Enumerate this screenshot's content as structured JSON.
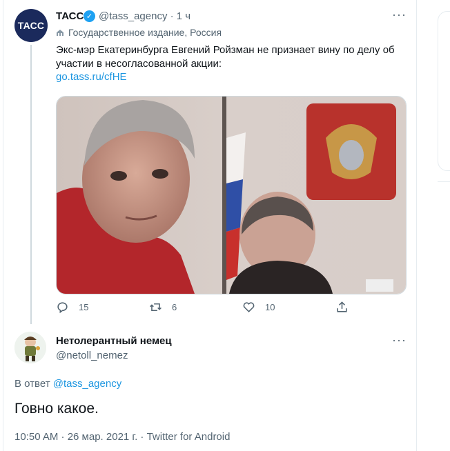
{
  "main_tweet": {
    "avatar_text": "ТАСС",
    "author_name": "ТАСС",
    "handle": "@tass_agency",
    "separator": "·",
    "age": "1 ч",
    "label": "Государственное издание, Россия",
    "text": "Экс-мэр Екатеринбурга Евгений Ройзман не признает вину по делу об участии в несогласованной акции:",
    "link": "go.tass.ru/cfHE",
    "stats": {
      "replies": "15",
      "retweets": "6",
      "likes": "10"
    }
  },
  "reply_tweet": {
    "author_name": "Нетолерантный немец",
    "handle": "@netoll_nemez",
    "reply_prefix": "В ответ",
    "reply_handle": "@tass_agency",
    "text": "Говно какое.",
    "timestamp": "10:50 AM · 26 мар. 2021 г. · Twitter for Android"
  },
  "icons": [
    "verified-icon",
    "more-icon",
    "building-icon",
    "reply-icon",
    "retweet-icon",
    "like-icon",
    "share-icon"
  ],
  "colors": {
    "accent": "#1b95e0",
    "verified": "#1da1f2",
    "muted": "#536471",
    "tass_brand": "#1b2a5c"
  }
}
